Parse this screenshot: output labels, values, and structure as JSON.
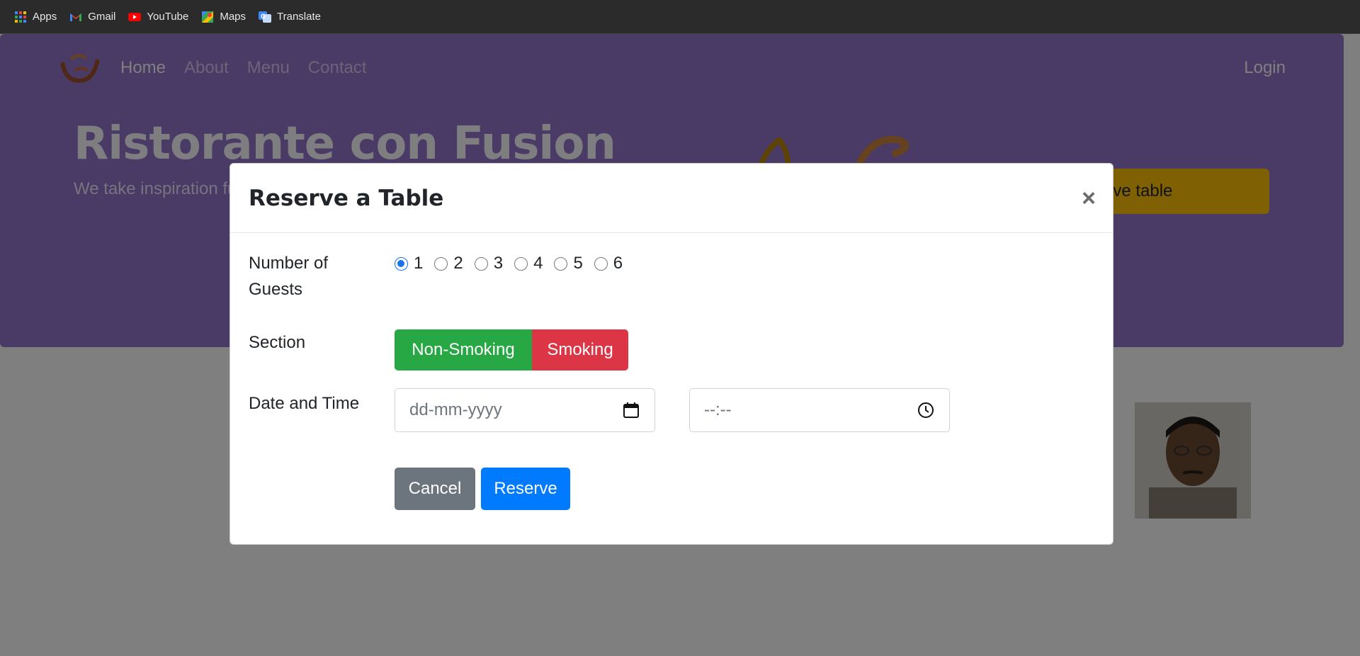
{
  "bookmarks": [
    {
      "label": "Apps",
      "icon": "apps-grid-icon"
    },
    {
      "label": "Gmail",
      "icon": "gmail-icon"
    },
    {
      "label": "YouTube",
      "icon": "youtube-icon"
    },
    {
      "label": "Maps",
      "icon": "maps-icon"
    },
    {
      "label": "Translate",
      "icon": "translate-icon"
    }
  ],
  "navbar": {
    "links": [
      "Home",
      "About",
      "Menu",
      "Contact"
    ],
    "active": "Home",
    "login": "Login"
  },
  "hero": {
    "title": "Ristorante con Fusion",
    "text": "We take inspiration fusion experience. C senses!",
    "cta": "Reserve table",
    "cta_visible": "erve table"
  },
  "modal": {
    "title": "Reserve a Table",
    "close": "×",
    "guests_label": "Number of Guests",
    "guest_options": [
      "1",
      "2",
      "3",
      "4",
      "5",
      "6"
    ],
    "guests_selected": "1",
    "section_label": "Section",
    "section_options": [
      "Non-Smoking",
      "Smoking"
    ],
    "datetime_label": "Date and Time",
    "date_placeholder": "dd-mm-yyyy",
    "time_placeholder": "--:--",
    "cancel_label": "Cancel",
    "reserve_label": "Reserve"
  },
  "colors": {
    "jumbotron": "#9575cd",
    "cta": "#ffc107",
    "non_smoking": "#28a745",
    "smoking": "#dc3545",
    "cancel": "#6c757d",
    "reserve": "#007bff"
  }
}
